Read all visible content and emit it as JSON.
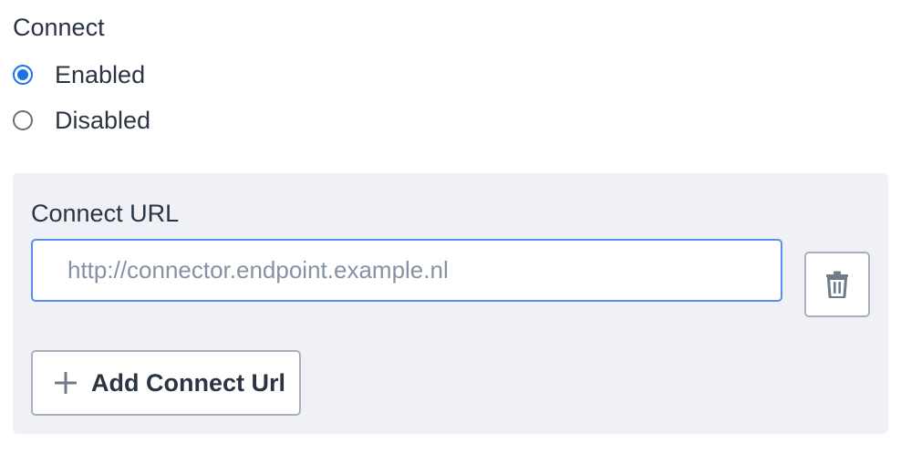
{
  "connect": {
    "label": "Connect",
    "options": [
      {
        "label": "Enabled",
        "selected": true
      },
      {
        "label": "Disabled",
        "selected": false
      }
    ]
  },
  "connect_url": {
    "label": "Connect URL",
    "value": "",
    "placeholder": "http://connector.endpoint.example.nl",
    "delete_icon": "trash-icon"
  },
  "add_button": {
    "icon": "plus-icon",
    "label": "Add Connect Url"
  },
  "colors": {
    "accent": "#1a73e8",
    "panel_bg": "#eff1f6",
    "input_border_focus": "#5b8def",
    "text": "#2b3443",
    "placeholder": "#8592a4"
  }
}
